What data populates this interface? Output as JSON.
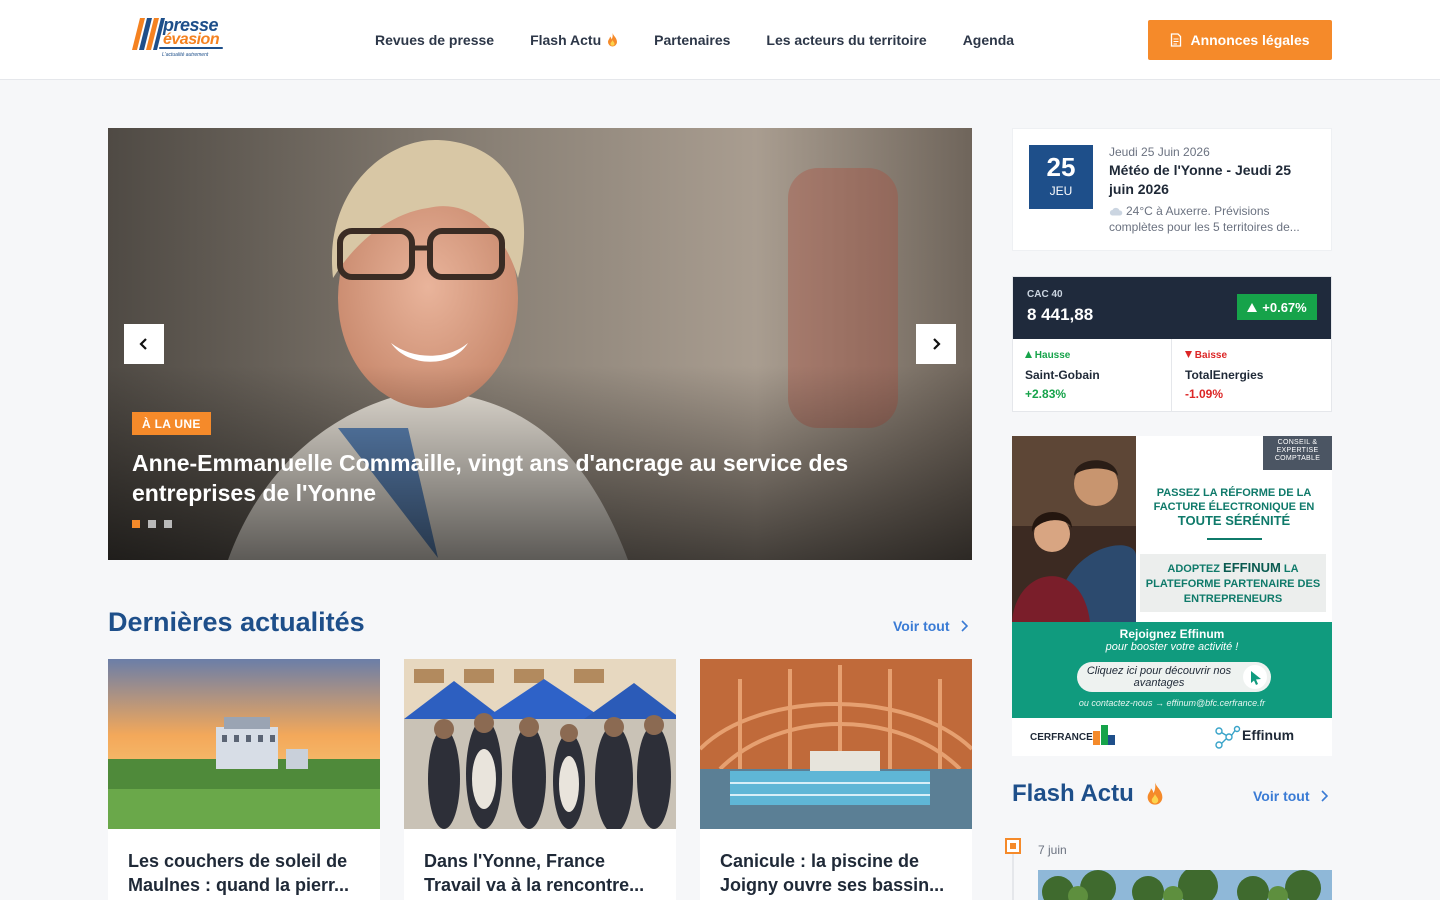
{
  "brand": {
    "name_line1": "presse",
    "name_line2": "évasion",
    "tagline": "L'actualité autrement"
  },
  "nav": {
    "items": [
      "Revues de presse",
      "Flash Actu",
      "Partenaires",
      "Les acteurs du territoire",
      "Agenda"
    ],
    "legal_button": "Annonces légales"
  },
  "hero": {
    "badge": "À LA UNE",
    "title": "Anne-Emmanuelle Commaille, vingt ans d'ancrage au service des entreprises de l'Yonne",
    "slides": 3,
    "active_slide": 1
  },
  "latest": {
    "title": "Dernières actualités",
    "see_all": "Voir tout",
    "cards": [
      {
        "title": "Les couchers de soleil de Maulnes : quand la pierr..."
      },
      {
        "title": "Dans l'Yonne, France Travail va à la rencontre..."
      },
      {
        "title": "Canicule : la piscine de Joigny ouvre ses bassin..."
      }
    ]
  },
  "weather": {
    "day_num": "25",
    "day_short": "JEU",
    "date_line": "Jeudi 25 Juin 2026",
    "title": "Météo de l'Yonne - Jeudi 25 juin 2026",
    "desc": "24°C à Auxerre. Prévisions complètes pour les 5 territoires de..."
  },
  "market": {
    "index": "CAC 40",
    "value": "8 441,88",
    "change": "+0.67%",
    "up_label": "Hausse",
    "up_name": "Saint-Gobain",
    "up_pct": "+2.83%",
    "down_label": "Baisse",
    "down_name": "TotalEnergies",
    "down_pct": "-1.09%"
  },
  "ad": {
    "tag": "CONSEIL & EXPERTISE COMPTABLE",
    "headline_a": "PASSEZ LA RÉFORME DE LA FACTURE ÉLECTRONIQUE EN",
    "headline_b": "TOUTE SÉRÉNITÉ",
    "sub_a": "ADOPTEZ",
    "sub_b": "EFFINUM",
    "sub_c": "LA PLATEFORME PARTENAIRE DES ENTREPRENEURS",
    "join": "Rejoignez Effinum",
    "boost": "pour booster votre activité !",
    "cta": "Cliquez ici pour découvrir nos avantages",
    "contact": "ou contactez-nous → effinum@bfc.cerfrance.fr",
    "logo_left": "CERFRANCE",
    "logo_right": "Effinum"
  },
  "flash": {
    "title": "Flash Actu",
    "see_all": "Voir tout",
    "first_date": "7 juin"
  },
  "colors": {
    "brand_blue": "#1e4f8a",
    "accent_orange": "#f58a2a",
    "up_green": "#16a34a",
    "down_red": "#dc2626"
  }
}
